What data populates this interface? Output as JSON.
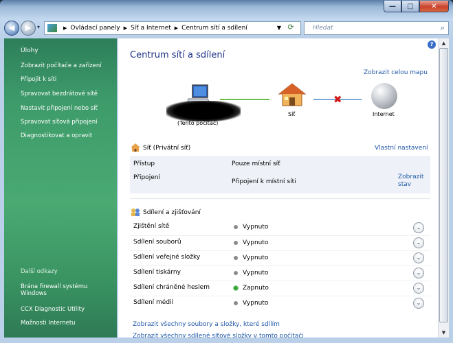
{
  "window": {
    "minimize_glyph": "—",
    "maximize_glyph": "□",
    "close_glyph": "✕"
  },
  "nav": {
    "breadcrumb": [
      "Ovládací panely",
      "Síť a Internet",
      "Centrum sítí a sdílení"
    ],
    "search_placeholder": "Hledat"
  },
  "sidebar": {
    "tasks_heading": "Úlohy",
    "tasks": [
      "Zobrazit počítače a zařízení",
      "Připojit k síti",
      "Spravovat bezdrátové sítě",
      "Nastavit připojení nebo síť",
      "Spravovat síťová připojení",
      "Diagnostikovat a opravit"
    ],
    "links_heading": "Další odkazy",
    "links": [
      "Brána firewall systému Windows",
      "CCX Diagnostic Utility",
      "Možnosti Internetu"
    ]
  },
  "main": {
    "title": "Centrum sítí a sdílení",
    "full_map_link": "Zobrazit celou mapu",
    "map": {
      "computer_label": "(Tento počítač)",
      "network_label": "Síť",
      "internet_label": "Internet"
    },
    "network": {
      "heading": "Síť (Privátní síť)",
      "custom_link": "Vlastní nastavení",
      "rows": [
        {
          "label": "Přístup",
          "value": "Pouze místní síť"
        },
        {
          "label": "Připojení",
          "value": "Připojení k místní síti"
        }
      ],
      "status_link_1": "Zobrazit",
      "status_link_2": "stav"
    },
    "sharing": {
      "heading": "Sdílení a zjišťování",
      "rows": [
        {
          "label": "Zjištění sítě",
          "status": "Vypnuto",
          "on": false
        },
        {
          "label": "Sdílení souborů",
          "status": "Vypnuto",
          "on": false
        },
        {
          "label": "Sdílení veřejné složky",
          "status": "Vypnuto",
          "on": false
        },
        {
          "label": "Sdílení tiskárny",
          "status": "Vypnuto",
          "on": false
        },
        {
          "label": "Sdílení chráněné heslem",
          "status": "Zapnuto",
          "on": true
        },
        {
          "label": "Sdílení médií",
          "status": "Vypnuto",
          "on": false
        }
      ]
    },
    "bottom_links": [
      "Zobrazit všechny soubory a složky, které sdílím",
      "Zobrazit všechny sdílené síťové složky v tomto počítači"
    ]
  },
  "colors": {
    "link": "#1f57a8",
    "title": "#1e3287",
    "sidebar": "#3d9a6a"
  }
}
